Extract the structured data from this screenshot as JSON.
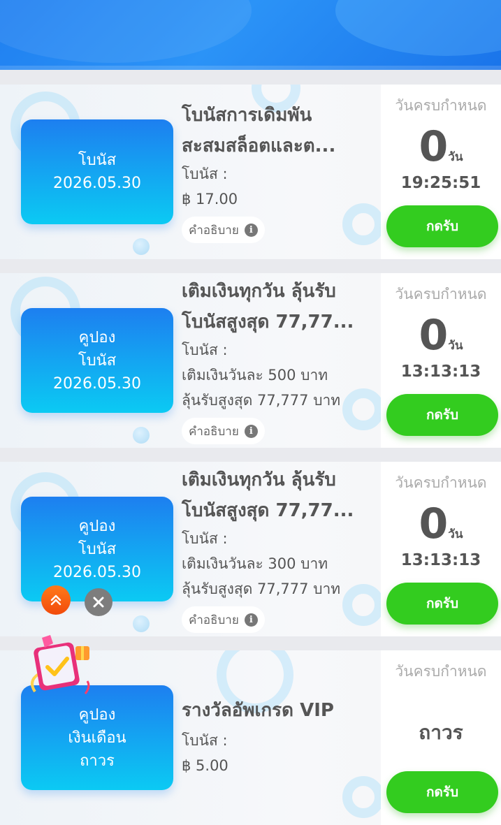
{
  "colors": {
    "header": "#1f7ff0",
    "ticket_top": "#1d7ff0",
    "ticket_bottom": "#0bcaf3",
    "claim_button": "#33cc1f",
    "scroll_top_button": "#f24a0a",
    "close_button": "#7d7d7d"
  },
  "cards": [
    {
      "ticket_lines": [
        "โบนัส",
        "2026.05.30"
      ],
      "title_line1": "โบนัสการเดิมพัน",
      "title_line2": "สะสมสล็อตและต...",
      "bonus_label": "โบนัส :",
      "desc_lines": [
        "฿ 17.00"
      ],
      "info_label": "คำอธิบาย",
      "deadline_label": "วันครบกำหนด",
      "days": "0",
      "days_unit": "วัน",
      "time": "19:25:51",
      "permanent": "",
      "claim_label": "กดรับ"
    },
    {
      "ticket_lines": [
        "คูปอง",
        "โบนัส",
        "2026.05.30"
      ],
      "title_line1": "เติมเงินทุกวัน ลุ้นรับ",
      "title_line2": "โบนัสสูงสุด 77,77...",
      "bonus_label": "โบนัส :",
      "desc_lines": [
        "เติมเงินวันละ 500 บาท",
        "ลุ้นรับสูงสุด 77,777 บาท"
      ],
      "info_label": "คำอธิบาย",
      "deadline_label": "วันครบกำหนด",
      "days": "0",
      "days_unit": "วัน",
      "time": "13:13:13",
      "permanent": "",
      "claim_label": "กดรับ"
    },
    {
      "ticket_lines": [
        "คูปอง",
        "โบนัส",
        "2026.05.30"
      ],
      "title_line1": "เติมเงินทุกวัน ลุ้นรับ",
      "title_line2": "โบนัสสูงสุด 77,77...",
      "bonus_label": "โบนัส :",
      "desc_lines": [
        "เติมเงินวันละ 300 บาท",
        "ลุ้นรับสูงสุด 77,777 บาท"
      ],
      "info_label": "คำอธิบาย",
      "deadline_label": "วันครบกำหนด",
      "days": "0",
      "days_unit": "วัน",
      "time": "13:13:13",
      "permanent": "",
      "claim_label": "กดรับ"
    },
    {
      "ticket_lines": [
        "คูปอง",
        "เงินเดือน",
        "ถาวร"
      ],
      "title_line1": "รางวัลอัพเกรด VIP",
      "title_line2": "",
      "bonus_label": "โบนัส :",
      "desc_lines": [
        "฿ 5.00"
      ],
      "info_label": "",
      "deadline_label": "วันครบกำหนด",
      "days": "",
      "days_unit": "",
      "time": "",
      "permanent": "ถาวร",
      "claim_label": "กดรับ"
    }
  ]
}
